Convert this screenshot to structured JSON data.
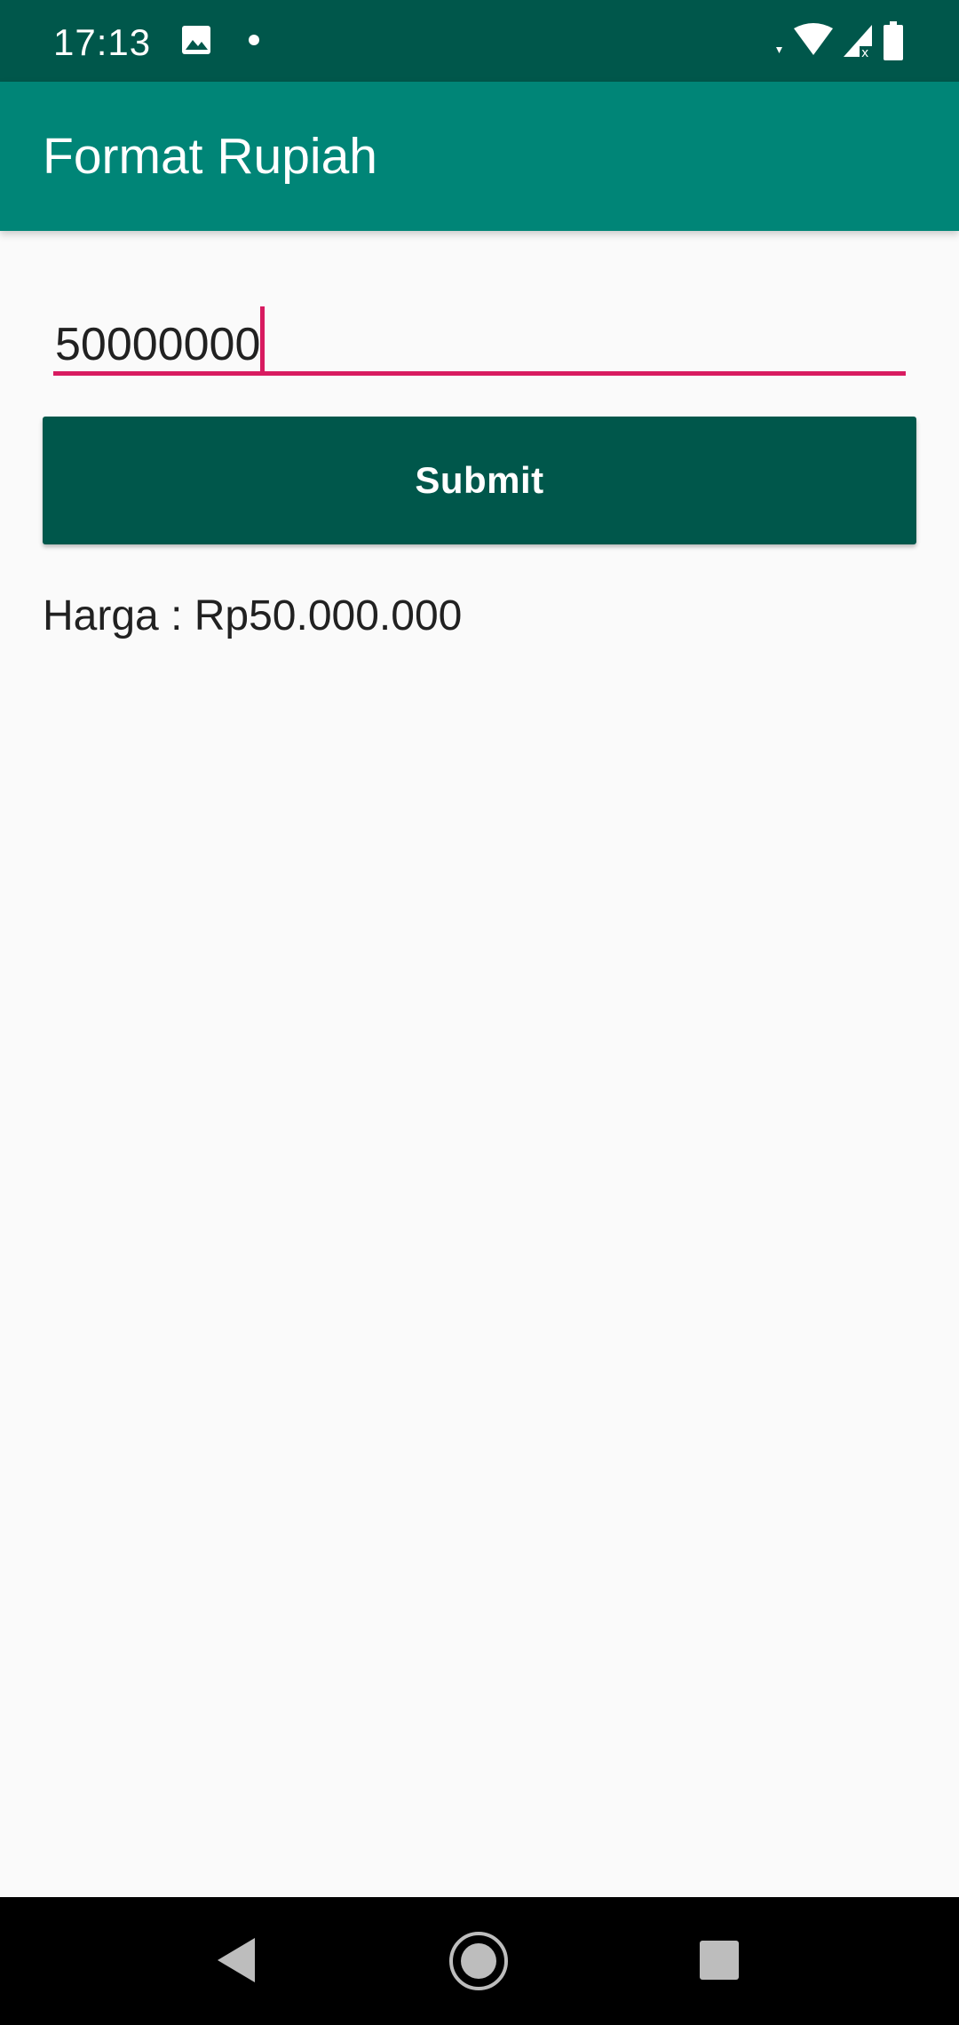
{
  "status_bar": {
    "time": "17:13",
    "icons": [
      "image-icon",
      "notification-dot-icon",
      "wifi-icon",
      "signal-icon",
      "battery-icon"
    ]
  },
  "app_bar": {
    "title": "Format Rupiah"
  },
  "form": {
    "input_value": "50000000",
    "submit_label": "Submit"
  },
  "result": {
    "text": "Harga : Rp50.000.000"
  },
  "nav_bar": {
    "icons": [
      "back-icon",
      "home-icon",
      "recents-icon"
    ]
  },
  "colors": {
    "status_bar": "#00574b",
    "app_bar": "#008577",
    "accent": "#d81b60",
    "button": "#00574b",
    "background": "#fafafa"
  }
}
